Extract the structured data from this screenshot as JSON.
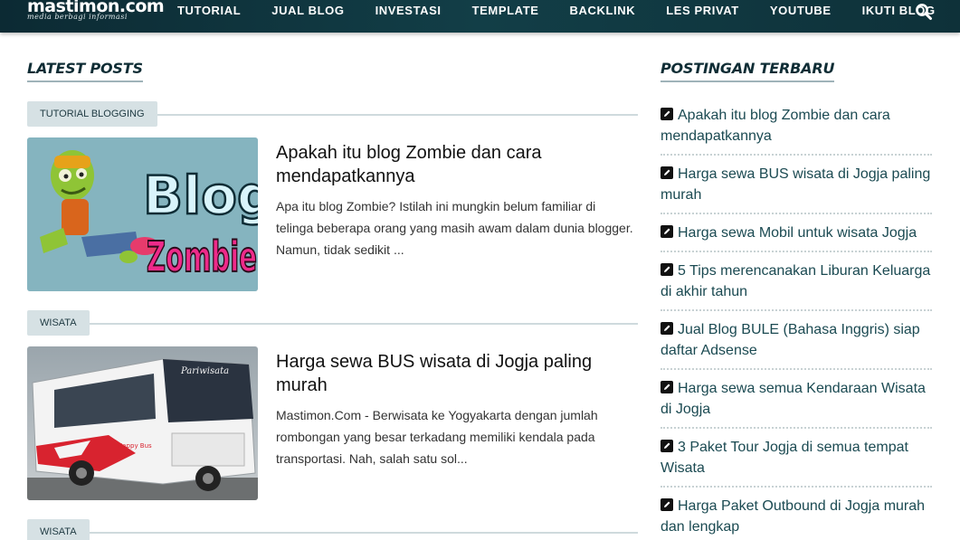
{
  "header": {
    "logo_main": "mastimon.com",
    "logo_tagline": "media berbagi informasi",
    "nav": [
      "TUTORIAL",
      "JUAL BLOG",
      "INVESTASI",
      "TEMPLATE",
      "BACKLINK",
      "LES PRIVAT",
      "YOUTUBE",
      "IKUTI BLOG"
    ],
    "search_icon": "search-icon"
  },
  "latest": {
    "title": "LATEST POSTS",
    "posts": [
      {
        "category": "TUTORIAL BLOGGING",
        "title": "Apakah itu blog Zombie dan cara mendapatkannya",
        "excerpt": "Apa itu blog Zombie? Istilah ini mungkin belum familiar di telinga beberapa orang yang masih awam dalam dunia blogger. Namun, tidak sedikit ...",
        "thumb_text_1": "Blog",
        "thumb_text_2": "Zombie"
      },
      {
        "category": "WISATA",
        "title": "Harga sewa BUS wisata di Jogja paling murah",
        "excerpt": "Mastimon.Com - Berwisata ke Yogyakarta dengan jumlah rombongan yang besar terkadang memiliki kendala pada transportasi. Nah, salah satu sol...",
        "thumb_text_1": "Pariwisata",
        "thumb_text_2": "Happy Bus"
      },
      {
        "category": "WISATA"
      }
    ]
  },
  "recent": {
    "title": "POSTINGAN TERBARU",
    "items": [
      "Apakah itu blog Zombie dan cara mendapatkannya",
      "Harga sewa BUS wisata di Jogja paling murah",
      "Harga sewa Mobil untuk wisata Jogja",
      "5 Tips merencanakan Liburan Keluarga di akhir tahun",
      "Jual Blog BULE (Bahasa Inggris) siap daftar Adsense",
      "Harga sewa semua Kendaraan Wisata di Jogja",
      "3 Paket Tour Jogja di semua tempat Wisata",
      "Harga Paket Outbound di Jogja murah dan lengkap"
    ]
  },
  "colors": {
    "header_bg": "#123e47",
    "title_text": "#0f2d35",
    "badge_bg": "#d6e1e4",
    "link": "#1b4a52"
  }
}
